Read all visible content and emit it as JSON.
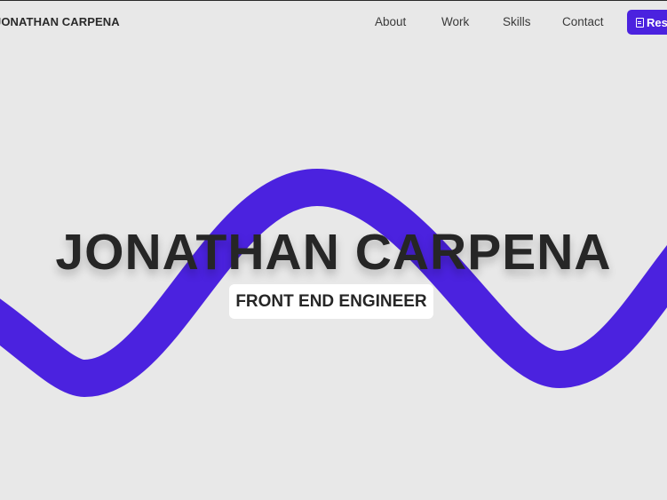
{
  "header": {
    "brand": "JONATHAN CARPENA",
    "nav": [
      {
        "label": "About"
      },
      {
        "label": "Work"
      },
      {
        "label": "Skills"
      },
      {
        "label": "Contact"
      }
    ],
    "resume_label": "Res"
  },
  "hero": {
    "title": "JONATHAN CARPENA",
    "subtitle": "FRONT END ENGINEER"
  },
  "colors": {
    "background": "#e8e8e8",
    "accent": "#4b22df",
    "text": "#262626"
  },
  "icons": {
    "resume_icon": "document-icon"
  }
}
